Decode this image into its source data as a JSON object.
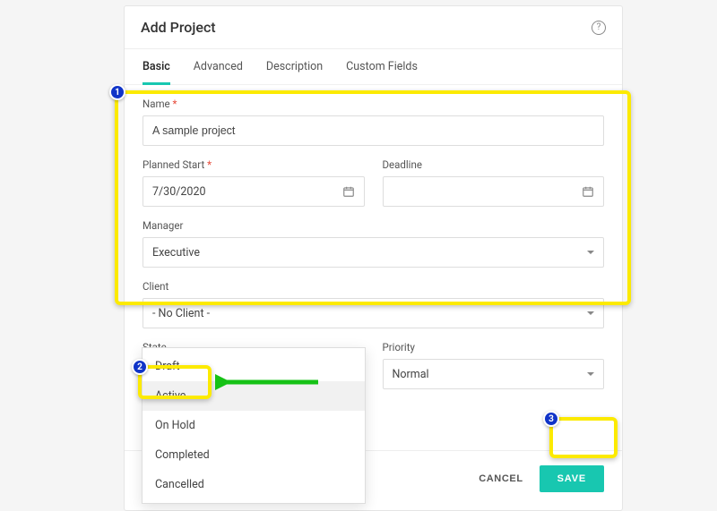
{
  "header": {
    "title": "Add Project"
  },
  "tabs": {
    "items": [
      "Basic",
      "Advanced",
      "Description",
      "Custom Fields"
    ],
    "active": 0
  },
  "form": {
    "name": {
      "label": "Name",
      "required": true,
      "value": "A sample project"
    },
    "plannedStart": {
      "label": "Planned Start",
      "required": true,
      "value": "7/30/2020"
    },
    "deadline": {
      "label": "Deadline",
      "value": ""
    },
    "manager": {
      "label": "Manager",
      "value": "Executive"
    },
    "client": {
      "label": "Client",
      "value": "- No Client -"
    },
    "state": {
      "label": "State",
      "value": "Active",
      "options": [
        "Draft",
        "Active",
        "On Hold",
        "Completed",
        "Cancelled"
      ],
      "open": true,
      "selectedIndex": 1
    },
    "priority": {
      "label": "Priority",
      "value": "Normal"
    }
  },
  "footer": {
    "cancel": "CANCEL",
    "save": "SAVE"
  },
  "annotations": {
    "badge1": "1",
    "badge2": "2",
    "badge3": "3"
  }
}
